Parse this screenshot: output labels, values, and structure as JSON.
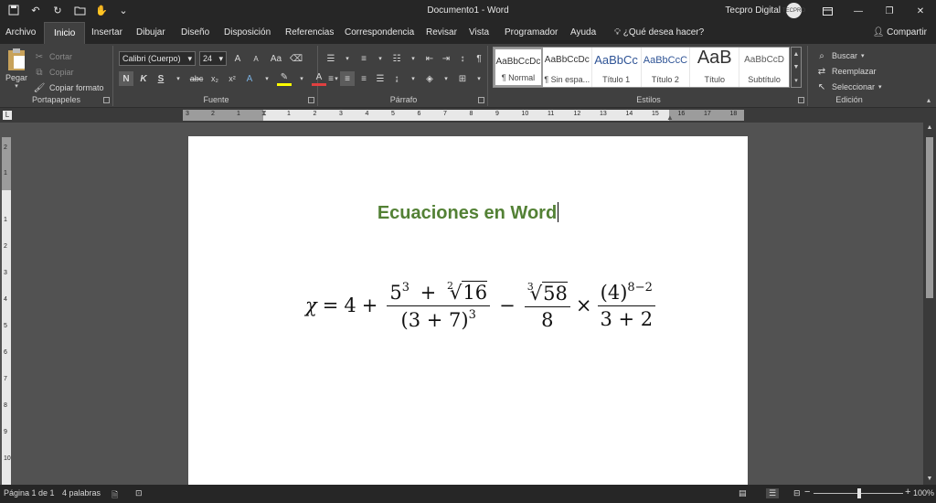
{
  "window": {
    "doc_title": "Documento1",
    "separator": " - ",
    "app_name": "Word",
    "user_name": "Tecpro Digital",
    "avatar_text": "TECPRO"
  },
  "tabs": {
    "archivo": "Archivo",
    "inicio": "Inicio",
    "insertar": "Insertar",
    "dibujar": "Dibujar",
    "diseno": "Diseño",
    "disposicion": "Disposición",
    "referencias": "Referencias",
    "correspondencia": "Correspondencia",
    "revisar": "Revisar",
    "vista": "Vista",
    "programador": "Programador",
    "ayuda": "Ayuda",
    "tell_me": "¿Qué desea hacer?",
    "share": "Compartir"
  },
  "ribbon": {
    "portapapeles": {
      "label": "Portapapeles",
      "pegar": "Pegar",
      "cortar": "Cortar",
      "copiar": "Copiar",
      "copiar_formato": "Copiar formato"
    },
    "fuente": {
      "label": "Fuente",
      "font_name": "Calibri (Cuerpo)",
      "font_size": "24",
      "bold": "N",
      "italic": "K",
      "underline": "S",
      "strike": "abc",
      "subscript": "x₂",
      "superscript": "x²",
      "grow": "A",
      "shrink": "A",
      "case": "Aa"
    },
    "parrafo": {
      "label": "Párrafo"
    },
    "estilos": {
      "label": "Estilos",
      "items": [
        {
          "preview": "AaBbCcDc",
          "name": "¶ Normal"
        },
        {
          "preview": "AaBbCcDc",
          "name": "¶ Sin espa..."
        },
        {
          "preview": "AaBbCc",
          "name": "Título 1"
        },
        {
          "preview": "AaBbCcC",
          "name": "Título 2"
        },
        {
          "preview": "AaB",
          "name": "Título"
        },
        {
          "preview": "AaBbCcD",
          "name": "Subtítulo"
        }
      ]
    },
    "edicion": {
      "label": "Edición",
      "buscar": "Buscar",
      "reemplazar": "Reemplazar",
      "seleccionar": "Seleccionar"
    }
  },
  "ruler": {
    "h_ticks": [
      "3",
      "2",
      "1",
      "1",
      "2",
      "3",
      "4",
      "5",
      "6",
      "7",
      "8",
      "9",
      "10",
      "11",
      "12",
      "13",
      "14",
      "15",
      "16",
      "17",
      "18"
    ],
    "v_ticks": [
      "2",
      "1",
      "1",
      "2",
      "3",
      "4",
      "5",
      "6",
      "7",
      "8",
      "9",
      "10"
    ]
  },
  "document": {
    "heading": "Ecuaciones en Word",
    "equation": {
      "lhs": "χ",
      "eq": "=",
      "t1": "4",
      "plus": "+",
      "f1_base": "5",
      "f1_exp": "3",
      "f1_plus": "+",
      "f1_root_index": "2",
      "f1_radicand": "16",
      "f1_den_open": "(3 + 7)",
      "f1_den_exp": "3",
      "minus": "−",
      "f2_root_index": "3",
      "f2_radicand": "58",
      "f2_den": "8",
      "times": "×",
      "f3_num": "(4)",
      "f3_num_exp": "8−2",
      "f3_den": "3 + 2"
    }
  },
  "status": {
    "page": "Página 1 de 1",
    "words": "4 palabras",
    "zoom_minus": "−",
    "zoom_plus": "+",
    "zoom": "100%"
  }
}
